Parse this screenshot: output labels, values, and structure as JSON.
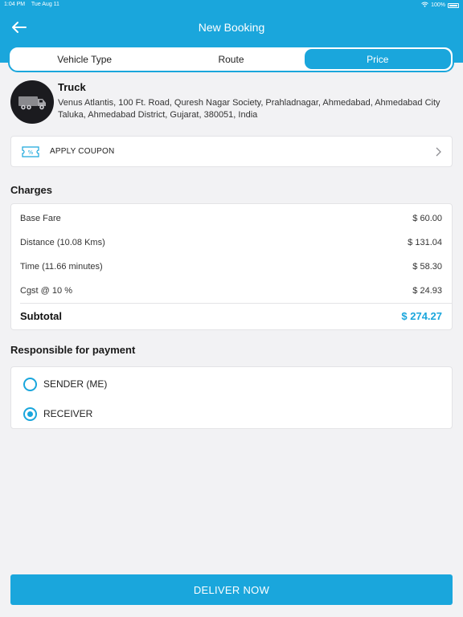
{
  "status_bar": {
    "time": "1:04 PM",
    "date": "Tue Aug 11",
    "battery": "100%"
  },
  "header": {
    "title": "New Booking",
    "back_icon": "arrow-left-icon"
  },
  "tabs": [
    {
      "label": "Vehicle Type",
      "active": false
    },
    {
      "label": "Route",
      "active": false
    },
    {
      "label": "Price",
      "active": true
    }
  ],
  "vehicle": {
    "name": "Truck",
    "address": "Venus Atlantis, 100 Ft. Road, Quresh Nagar Society, Prahladnagar, Ahmedabad, Ahmedabad City Taluka, Ahmedabad District, Gujarat, 380051, India",
    "icon": "truck-icon"
  },
  "coupon": {
    "label": "APPLY COUPON",
    "icon": "coupon-ticket-icon"
  },
  "charges": {
    "title": "Charges",
    "rows": [
      {
        "label": "Base Fare",
        "value": "$ 60.00"
      },
      {
        "label": "Distance (10.08 Kms)",
        "value": "$ 131.04"
      },
      {
        "label": "Time (11.66 minutes)",
        "value": "$ 58.30"
      },
      {
        "label": "Cgst @ 10 %",
        "value": "$ 24.93"
      }
    ],
    "subtotal_label": "Subtotal",
    "subtotal_value": "$ 274.27"
  },
  "payment": {
    "title": "Responsible for payment",
    "options": [
      {
        "label": "SENDER (ME)",
        "selected": false
      },
      {
        "label": "RECEIVER",
        "selected": true
      }
    ]
  },
  "actions": {
    "deliver_label": "DELIVER NOW"
  },
  "colors": {
    "accent": "#1aa6dc",
    "background": "#f2f2f4"
  }
}
